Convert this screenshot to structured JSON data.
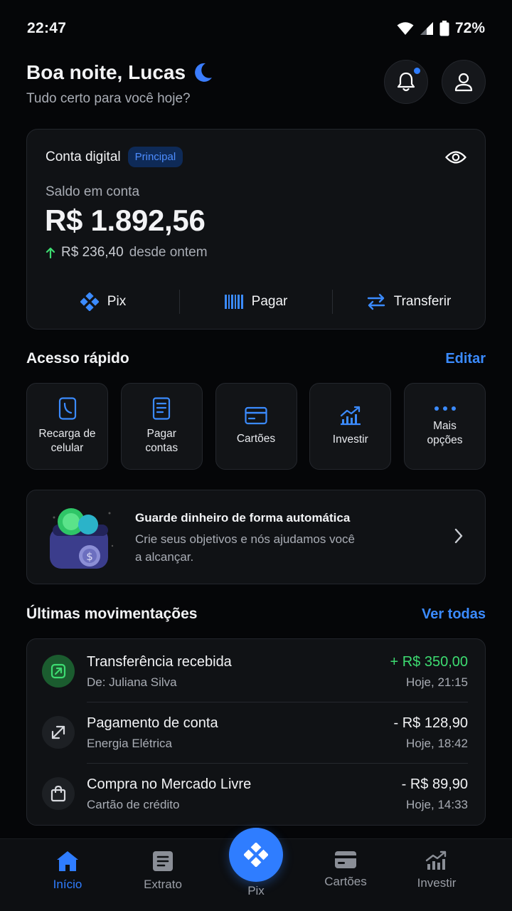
{
  "status": {
    "time": "22:47",
    "battery": "72%"
  },
  "header": {
    "greeting": "Boa noite, Lucas",
    "subtitle": "Tudo certo para você hoje?"
  },
  "balance_card": {
    "account_label": "Conta digital",
    "badge": "Principal",
    "balance_label": "Saldo em conta",
    "balance_value": "R$ 1.892,56",
    "delta_value": "R$ 236,40",
    "delta_suffix": "desde ontem",
    "actions": [
      {
        "label": "Pix",
        "icon": "pix-icon"
      },
      {
        "label": "Pagar",
        "icon": "barcode-icon"
      },
      {
        "label": "Transferir",
        "icon": "transfer-icon"
      }
    ]
  },
  "quick_access": {
    "title": "Acesso rápido",
    "edit_label": "Editar",
    "items": [
      {
        "label": "Recarga de\ncelular",
        "icon": "phone-icon"
      },
      {
        "label": "Pagar\ncontas",
        "icon": "receipt-icon"
      },
      {
        "label": "Cartões",
        "icon": "card-icon"
      },
      {
        "label": "Investir",
        "icon": "chart-icon"
      },
      {
        "label": "Mais\nopções",
        "icon": "more-icon"
      }
    ]
  },
  "promo": {
    "title": "Guarde dinheiro de forma automática",
    "text": "Crie seus objetivos e nós ajudamos você a alcançar."
  },
  "transactions": {
    "title": "Últimas movimentações",
    "see_all_label": "Ver todas",
    "items": [
      {
        "title": "Transferência recebida",
        "subtitle": "De: Juliana Silva",
        "amount": "+ R$ 350,00",
        "date": "Hoje, 21:15",
        "icon": "arrow-in-icon",
        "positive": true
      },
      {
        "title": "Pagamento de conta",
        "subtitle": "Energia Elétrica",
        "amount": "- R$ 128,90",
        "date": "Hoje, 18:42",
        "icon": "arrow-out-icon",
        "positive": false
      },
      {
        "title": "Compra no Mercado Livre",
        "subtitle": "Cartão de crédito",
        "amount": "- R$ 89,90",
        "date": "Hoje, 14:33",
        "icon": "shopping-bag-icon",
        "positive": false
      }
    ]
  },
  "bottom_nav": {
    "items": [
      {
        "label": "Início",
        "icon": "home-icon",
        "active": true
      },
      {
        "label": "Extrato",
        "icon": "statement-icon",
        "active": false
      },
      {
        "label": "Pix",
        "icon": "pix-icon",
        "active": false
      },
      {
        "label": "Cartões",
        "icon": "card-icon",
        "active": false
      },
      {
        "label": "Investir",
        "icon": "chart-icon",
        "active": false
      }
    ]
  },
  "colors": {
    "accent": "#2f7dff",
    "positive": "#3ddc71",
    "background": "#050608",
    "card": "#101215"
  }
}
